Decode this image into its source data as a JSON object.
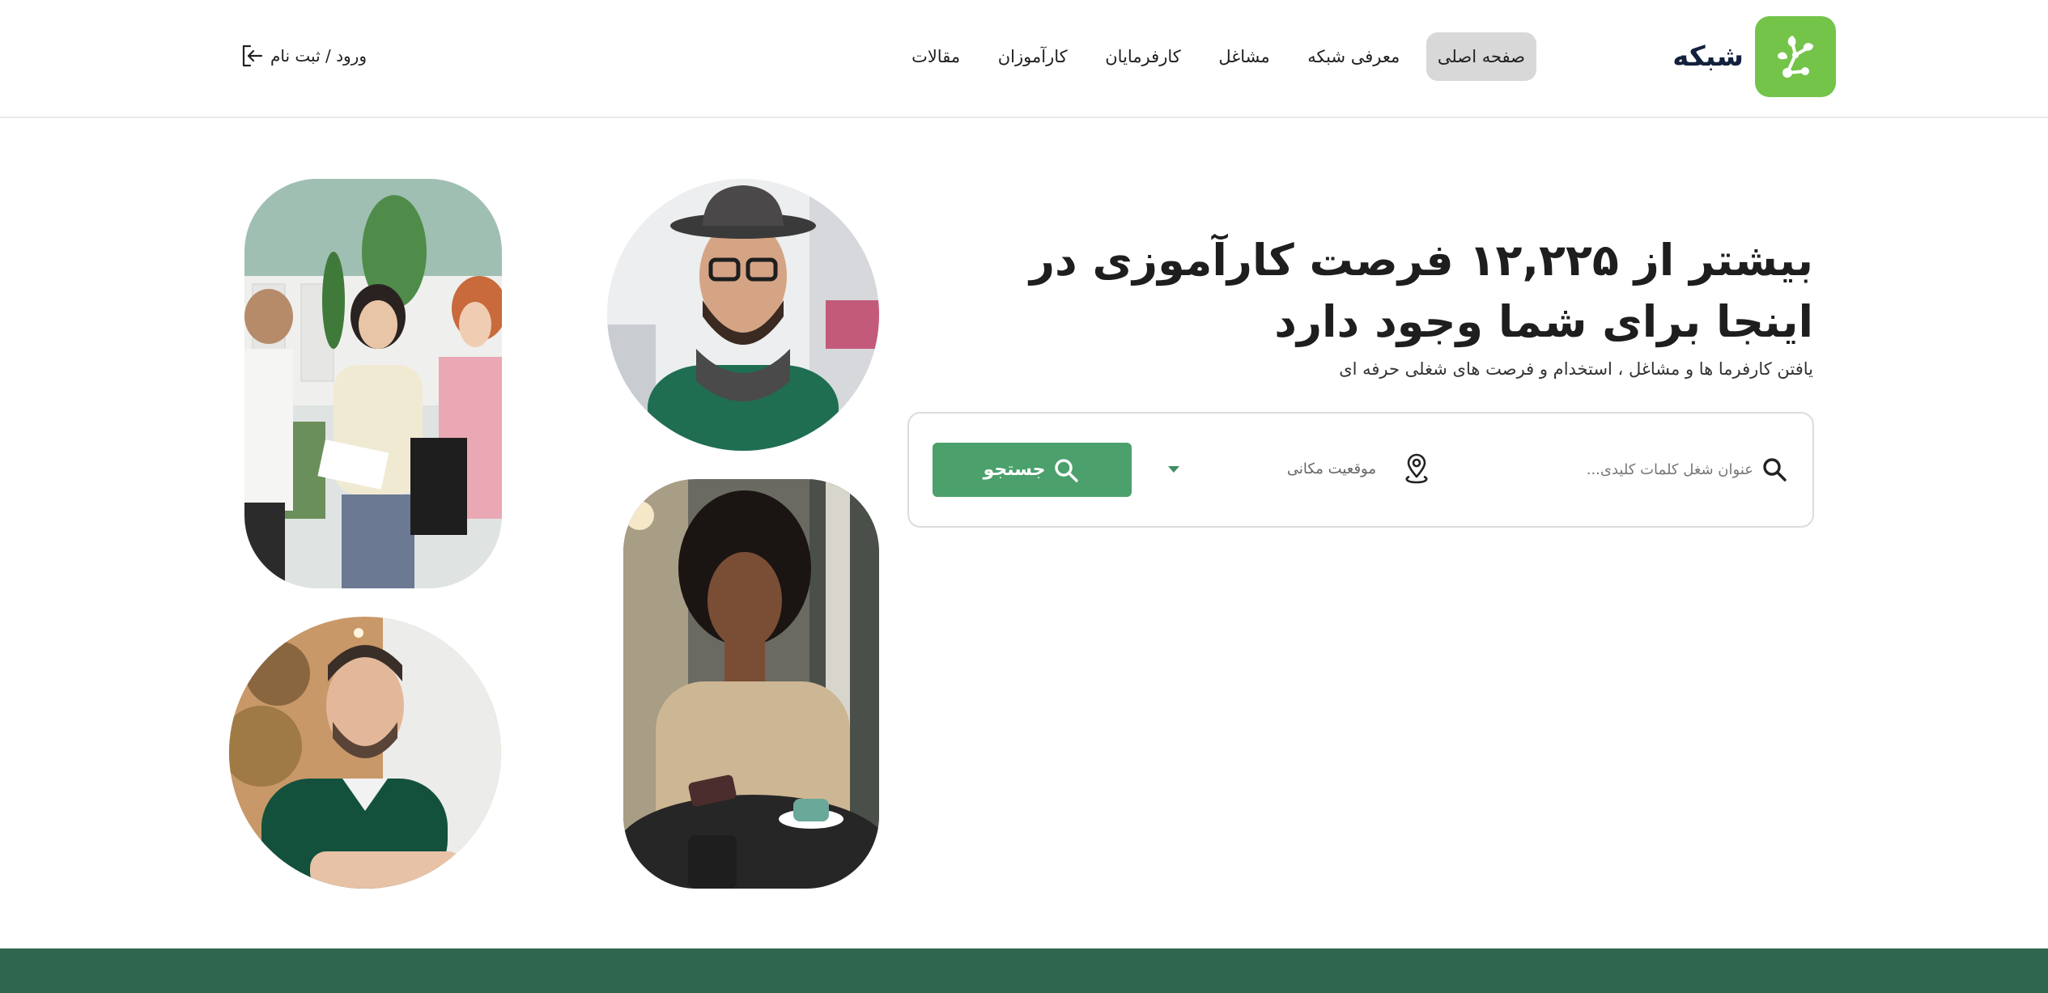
{
  "brand": {
    "name": "شبکه",
    "logo_color": "#74c44a",
    "logo_icon": "network-branch-icon"
  },
  "nav": {
    "items": [
      {
        "label": "صفحه اصلی",
        "active": true
      },
      {
        "label": "معرفی شبکه",
        "active": false
      },
      {
        "label": "مشاغل",
        "active": false
      },
      {
        "label": "کارفرمایان",
        "active": false
      },
      {
        "label": "کارآموزان",
        "active": false
      },
      {
        "label": "مقالات",
        "active": false
      }
    ]
  },
  "auth": {
    "login_label": "ورود / ثبت نام",
    "icon": "login-arrow-icon"
  },
  "hero": {
    "title": "بیشتر از ۱۲,۲۲۵ فرصت کارآموزی در اینجا برای شما وجود دارد",
    "subtitle": "یافتن کارفرما ها و مشاغل ، استخدام و فرصت های شغلی حرفه ای"
  },
  "search": {
    "keyword_placeholder": "عنوان شغل کلمات کلیدی...",
    "keyword_value": "",
    "location_label": "موقعیت مکانی",
    "button_label": "جستجو",
    "button_color": "#4ba06c"
  },
  "colors": {
    "accent": "#4ba06c",
    "footer": "#2e6650",
    "nav_active_bg": "#d8d8d8"
  }
}
